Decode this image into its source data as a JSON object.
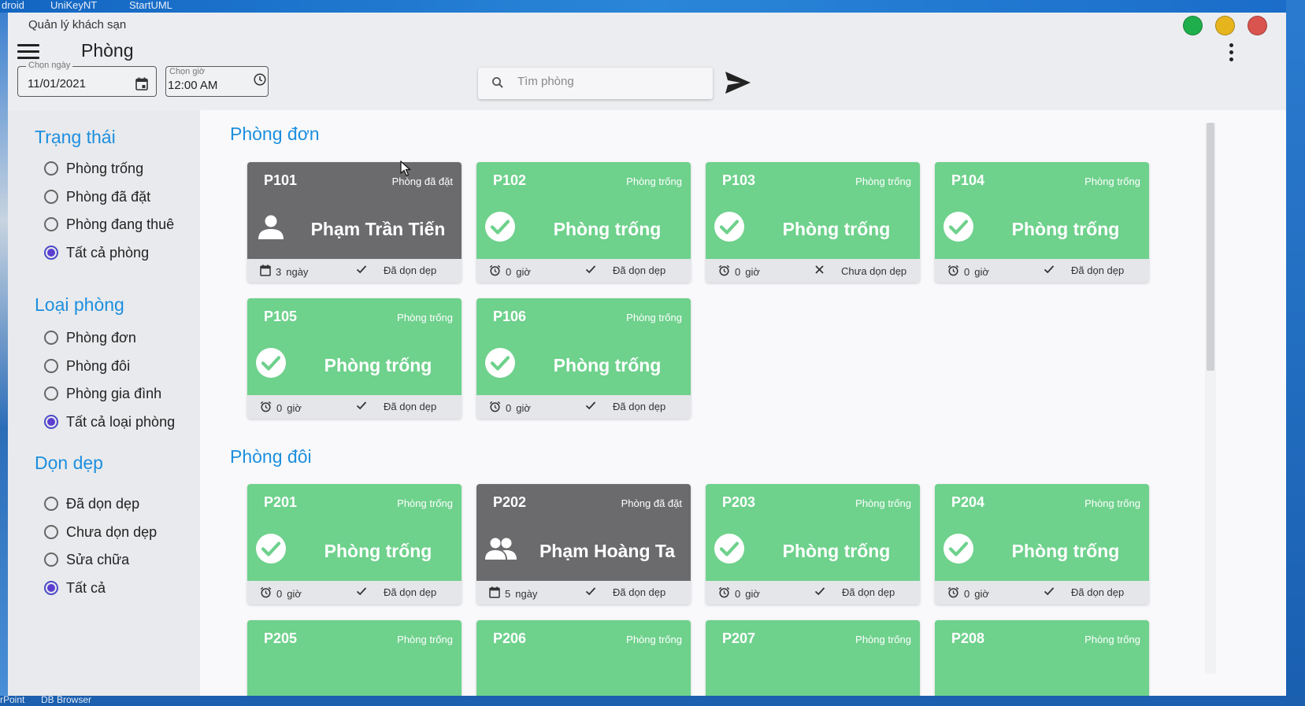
{
  "desktop": {
    "top_items": [
      "droid",
      "UniKeyNT",
      "StartUML"
    ],
    "bottom_items": [
      "rPoint",
      "DB Browser"
    ]
  },
  "window": {
    "title": "Quản lý khách sạn",
    "controls_colors": {
      "green": "#1fae4c",
      "yellow": "#e6b41d",
      "red": "#d9534f"
    }
  },
  "appbar": {
    "page_title": "Phòng",
    "date": {
      "label": "Chọn ngày",
      "value": "11/01/2021"
    },
    "time": {
      "label": "Chọn giờ",
      "value": "12:00 AM"
    },
    "search_placeholder": "Tìm phòng"
  },
  "filters": {
    "status": {
      "title": "Trạng thái",
      "options": [
        "Phòng trống",
        "Phòng đã đặt",
        "Phòng đang thuê",
        "Tất cả phòng"
      ],
      "selected": "Tất cả phòng"
    },
    "room_type": {
      "title": "Loại phòng",
      "options": [
        "Phòng đơn",
        "Phòng đôi",
        "Phòng gia đình",
        "Tất cả loại phòng"
      ],
      "selected": "Tất cả loại phòng"
    },
    "cleaning": {
      "title": "Dọn dẹp",
      "options": [
        "Đã dọn dẹp",
        "Chưa dọn dẹp",
        "Sửa chữa",
        "Tất cả"
      ],
      "selected": "Tất cả"
    }
  },
  "colors": {
    "accent": "#1d8fde",
    "free": "#6ed18c",
    "booked": "#6b6b6e",
    "radio_selected": "#5a3fd0"
  },
  "groups": [
    {
      "title": "Phòng đơn",
      "rooms": [
        {
          "code": "P101",
          "status": "Phòng đã đặt",
          "main": "Phạm Trần Tiến",
          "icon": "person-icon",
          "booked": true,
          "duration_icon": "calendar-icon",
          "duration": "3",
          "unit": "ngày",
          "clean_icon": "check-icon",
          "clean": "Đã dọn dẹp"
        },
        {
          "code": "P102",
          "status": "Phòng trống",
          "main": "Phòng trống",
          "icon": "check-circle-icon",
          "booked": false,
          "duration_icon": "alarm-icon",
          "duration": "0",
          "unit": "giờ",
          "clean_icon": "check-icon",
          "clean": "Đã dọn dẹp"
        },
        {
          "code": "P103",
          "status": "Phòng trống",
          "main": "Phòng trống",
          "icon": "check-circle-icon",
          "booked": false,
          "duration_icon": "alarm-icon",
          "duration": "0",
          "unit": "giờ",
          "clean_icon": "close-icon",
          "clean": "Chưa dọn dẹp"
        },
        {
          "code": "P104",
          "status": "Phòng trống",
          "main": "Phòng trống",
          "icon": "check-circle-icon",
          "booked": false,
          "duration_icon": "alarm-icon",
          "duration": "0",
          "unit": "giờ",
          "clean_icon": "check-icon",
          "clean": "Đã dọn dẹp"
        },
        {
          "code": "P105",
          "status": "Phòng trống",
          "main": "Phòng trống",
          "icon": "check-circle-icon",
          "booked": false,
          "duration_icon": "alarm-icon",
          "duration": "0",
          "unit": "giờ",
          "clean_icon": "check-icon",
          "clean": "Đã dọn dẹp"
        },
        {
          "code": "P106",
          "status": "Phòng trống",
          "main": "Phòng trống",
          "icon": "check-circle-icon",
          "booked": false,
          "duration_icon": "alarm-icon",
          "duration": "0",
          "unit": "giờ",
          "clean_icon": "check-icon",
          "clean": "Đã dọn dẹp"
        }
      ]
    },
    {
      "title": "Phòng đôi",
      "rooms": [
        {
          "code": "P201",
          "status": "Phòng trống",
          "main": "Phòng trống",
          "icon": "check-circle-icon",
          "booked": false,
          "duration_icon": "alarm-icon",
          "duration": "0",
          "unit": "giờ",
          "clean_icon": "check-icon",
          "clean": "Đã dọn dẹp"
        },
        {
          "code": "P202",
          "status": "Phòng đã đặt",
          "main": "Phạm Hoàng Ta",
          "icon": "people-icon",
          "booked": true,
          "duration_icon": "calendar-icon",
          "duration": "5",
          "unit": "ngày",
          "clean_icon": "check-icon",
          "clean": "Đã dọn dẹp"
        },
        {
          "code": "P203",
          "status": "Phòng trống",
          "main": "Phòng trống",
          "icon": "check-circle-icon",
          "booked": false,
          "duration_icon": "alarm-icon",
          "duration": "0",
          "unit": "giờ",
          "clean_icon": "check-icon",
          "clean": "Đã dọn dẹp"
        },
        {
          "code": "P204",
          "status": "Phòng trống",
          "main": "Phòng trống",
          "icon": "check-circle-icon",
          "booked": false,
          "duration_icon": "alarm-icon",
          "duration": "0",
          "unit": "giờ",
          "clean_icon": "check-icon",
          "clean": "Đã dọn dẹp"
        },
        {
          "code": "P205",
          "status": "Phòng trống",
          "main": "",
          "icon": "",
          "booked": false,
          "duration_icon": "",
          "duration": "",
          "unit": "",
          "clean_icon": "",
          "clean": ""
        },
        {
          "code": "P206",
          "status": "Phòng trống",
          "main": "",
          "icon": "",
          "booked": false,
          "duration_icon": "",
          "duration": "",
          "unit": "",
          "clean_icon": "",
          "clean": ""
        },
        {
          "code": "P207",
          "status": "Phòng trống",
          "main": "",
          "icon": "",
          "booked": false,
          "duration_icon": "",
          "duration": "",
          "unit": "",
          "clean_icon": "",
          "clean": ""
        },
        {
          "code": "P208",
          "status": "Phòng trống",
          "main": "",
          "icon": "",
          "booked": false,
          "duration_icon": "",
          "duration": "",
          "unit": "",
          "clean_icon": "",
          "clean": ""
        }
      ]
    }
  ]
}
